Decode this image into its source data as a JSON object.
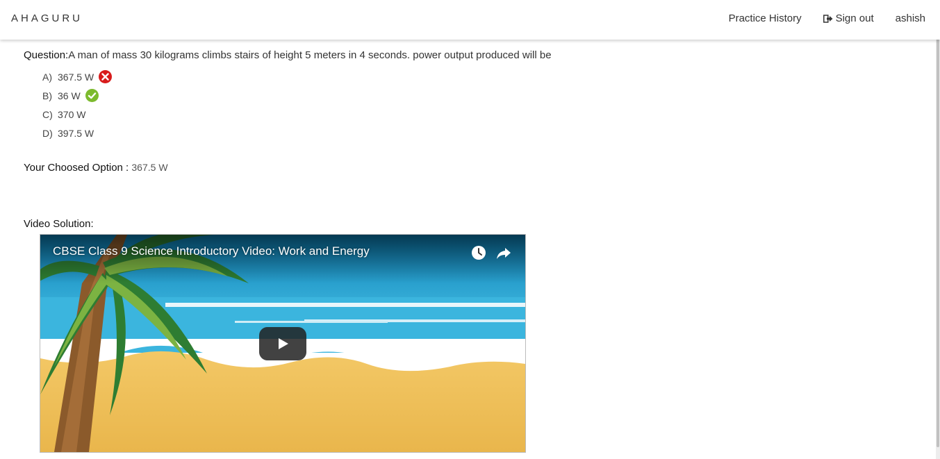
{
  "navbar": {
    "brand": "AHAGURU",
    "practice_history": "Practice History",
    "sign_out": "Sign out",
    "user": "ashish"
  },
  "question": {
    "label": "Question:",
    "text": "A man of mass 30 kilograms climbs stairs of height 5 meters in 4 seconds. power output produced will be"
  },
  "options": [
    {
      "letter": "A)",
      "text": "367.5 W",
      "mark": "wrong-icon"
    },
    {
      "letter": "B)",
      "text": "36 W",
      "mark": "correct-icon"
    },
    {
      "letter": "C)",
      "text": "370 W",
      "mark": ""
    },
    {
      "letter": "D)",
      "text": "397.5 W",
      "mark": ""
    }
  ],
  "chosen": {
    "label": "Your Choosed Option : ",
    "value": "367.5 W"
  },
  "video": {
    "section_label": "Video Solution:",
    "title": "CBSE Class 9 Science Introductory Video: Work and Energy",
    "icons": [
      "watch-later-icon",
      "share-icon",
      "play-icon"
    ]
  },
  "colors": {
    "wrong": "#d81b1b",
    "correct": "#7cba2e",
    "sky": "#3fb6e0",
    "sand": "#f0c35a"
  }
}
